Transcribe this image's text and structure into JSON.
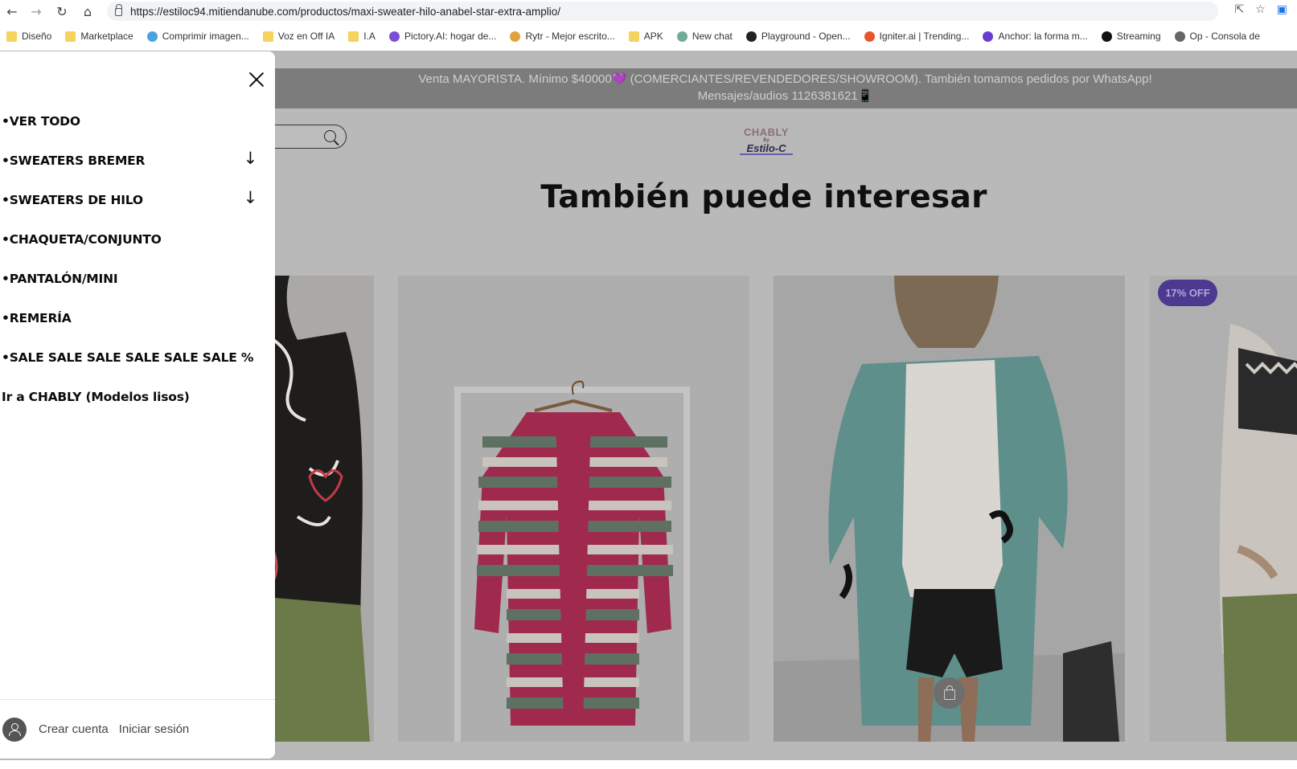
{
  "browser": {
    "url": "https://estiloc94.mitiendanube.com/productos/maxi-sweater-hilo-anabel-star-extra-amplio/",
    "bookmarks": [
      {
        "label": "Diseño",
        "icon": "folder-icon"
      },
      {
        "label": "Marketplace",
        "icon": "folder-icon"
      },
      {
        "label": "Comprimir imagen...",
        "icon": "leaf-icon"
      },
      {
        "label": "Voz en Off IA",
        "icon": "folder-icon"
      },
      {
        "label": "I.A",
        "icon": "folder-icon"
      },
      {
        "label": "Pictory.AI: hogar de...",
        "icon": "octopus-icon"
      },
      {
        "label": "Rytr - Mejor escrito...",
        "icon": "pen-icon"
      },
      {
        "label": "APK",
        "icon": "folder-icon"
      },
      {
        "label": "New chat",
        "icon": "chatgpt-icon"
      },
      {
        "label": "Playground - Open...",
        "icon": "openai-icon"
      },
      {
        "label": "Igniter.ai | Trending...",
        "icon": "igniter-icon"
      },
      {
        "label": "Anchor: la forma m...",
        "icon": "anchor-icon"
      },
      {
        "label": "Streaming",
        "icon": "streaming-icon"
      },
      {
        "label": "Op - Consola de",
        "icon": "link-icon"
      }
    ]
  },
  "store": {
    "banner": "Venta MAYORISTA. Mínimo $40000💜 (COMERCIANTES/REVENDEDORES/SHOWROOM). También tomamos pedidos por WhatsApp! Mensajes/audios 1126381621📱",
    "logo_top": "CHABLY",
    "logo_by": "By",
    "logo_bottom": "Estilo-C",
    "heading": "También puede interesar",
    "badge": "17% OFF"
  },
  "drawer": {
    "menu": [
      {
        "label": "•VER TODO",
        "has_children": false
      },
      {
        "label": "•SWEATERS BREMER",
        "has_children": true
      },
      {
        "label": "•SWEATERS DE HILO",
        "has_children": true
      },
      {
        "label": "•CHAQUETA/CONJUNTO",
        "has_children": false
      },
      {
        "label": "•PANTALÓN/MINI",
        "has_children": false
      },
      {
        "label": "•REMERÍA",
        "has_children": false
      },
      {
        "label": "•SALE SALE SALE SALE SALE SALE %",
        "has_children": false
      },
      {
        "label": "Ir a CHABLY (Modelos lisos)",
        "has_children": false
      }
    ],
    "expand_arrow": "↓",
    "create_account": "Crear cuenta",
    "login": "Iniciar sesión"
  }
}
